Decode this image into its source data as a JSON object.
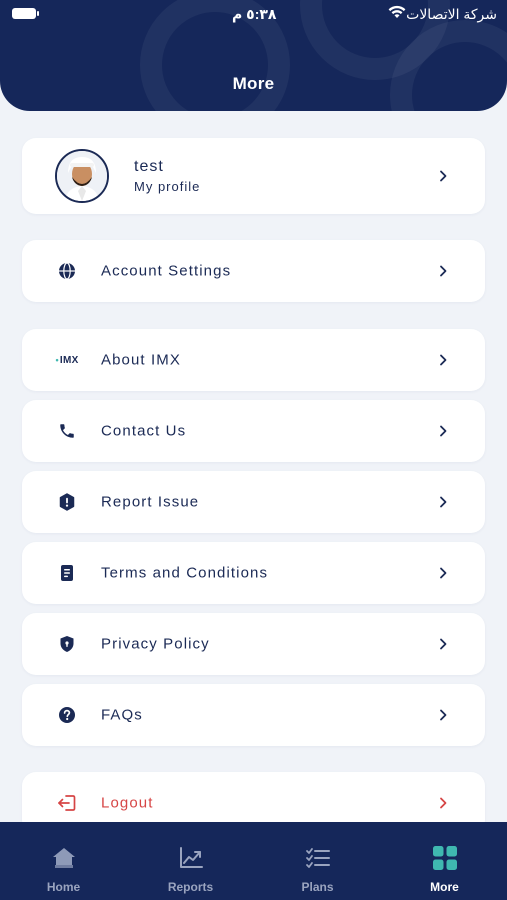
{
  "status_bar": {
    "time": "٥:٣٨ م",
    "carrier": "شركة الاتصالات"
  },
  "header": {
    "title": "More"
  },
  "profile": {
    "name": "test",
    "subtitle": "My profile"
  },
  "menu": {
    "account_settings": {
      "label": "Account Settings",
      "icon": "globe-icon"
    },
    "about": {
      "label": "About IMX",
      "icon": "imx-logo-icon",
      "logo_text": "IMX"
    },
    "contact": {
      "label": "Contact Us",
      "icon": "phone-icon"
    },
    "report": {
      "label": "Report Issue",
      "icon": "alert-icon"
    },
    "terms": {
      "label": "Terms and Conditions",
      "icon": "document-icon"
    },
    "privacy": {
      "label": "Privacy Policy",
      "icon": "shield-icon"
    },
    "faqs": {
      "label": "FAQs",
      "icon": "question-icon"
    },
    "logout": {
      "label": "Logout",
      "icon": "logout-icon"
    }
  },
  "tabbar": {
    "tabs": [
      {
        "label": "Home",
        "icon": "home-icon",
        "active": false
      },
      {
        "label": "Reports",
        "icon": "chart-icon",
        "active": false
      },
      {
        "label": "Plans",
        "icon": "checklist-icon",
        "active": false
      },
      {
        "label": "More",
        "icon": "grid-icon",
        "active": true
      }
    ]
  },
  "colors": {
    "navy": "#15275a",
    "text": "#1b2a55",
    "background": "#f0f3f8",
    "logout_red": "#d64545",
    "active_teal": "#3fb8b0",
    "inactive_tab": "#9aa4bf"
  }
}
